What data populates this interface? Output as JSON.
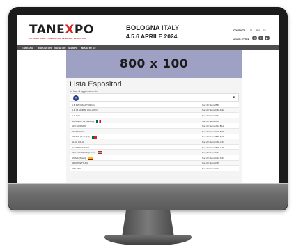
{
  "header": {
    "logo_prefix": "TANE",
    "logo_x": "X",
    "logo_suffix": "PO",
    "logo_sub": "INTERNATIONAL FUNERAL AND CEMETERY EXHIBITION",
    "city_bold": "BOLOGNA",
    "city_rest": " ITALY",
    "date": "4.5.6 APRILE 2024",
    "contatti": "CONTATTI",
    "languages": [
      "IT",
      "EN",
      "ES"
    ],
    "newsletter": "NEWSLETTER"
  },
  "nav": {
    "items": [
      "TANEXPO",
      "ESPOSITORI",
      "VISITATORI",
      "STAMPA",
      "INDUSTRY 4.0"
    ]
  },
  "banner": {
    "text": "800 x 100"
  },
  "list": {
    "title": "Lista Espositori",
    "subtitle": "In fase di aggiornamento",
    "filter_letter": "A",
    "filter_arrow": "▾"
  },
  "exhibitors": [
    {
      "name": "A.B.MANUFACTURING",
      "stand": "Hall 30 Stand B30"
    },
    {
      "name": "A.F. DI MARINI GIULIANO",
      "stand": "Hall 29 Stand D40-D42"
    },
    {
      "name": "A.G.O.D.",
      "stand": "Hall 29 Stand E34"
    },
    {
      "name": "AGNALAVITE (Mexico)",
      "stand": "Hall 30 Stand B06",
      "flag": "mexico"
    },
    {
      "name": "AFO CESARIO",
      "stand": "Hall 29 Stand A14-B11"
    },
    {
      "name": "AFFRESCO",
      "stand": "Hall 29 Stand E10-B31"
    },
    {
      "name": "AHMAR (Portugal)",
      "stand": "Hall 29 Stand B36-B41",
      "flag": "portugal"
    },
    {
      "name": "ALDA ITALIA",
      "stand": "Hall 29 Stand C30-C34"
    },
    {
      "name": "ALTAIR FUNERAL",
      "stand": "Hall 29 Stand B06-C11"
    },
    {
      "name": "ANGEL VIDEOS (Latvia)",
      "stand": "Hall 30 Stand E71",
      "flag": "latvia"
    },
    {
      "name": "ANIMA (Spain)",
      "stand": "Hall 29 Stand D22-D31",
      "flag": "spain"
    },
    {
      "name": "ARCHITETTURA",
      "stand": "Hall 29 Stand D35"
    },
    {
      "name": "ARGENIA",
      "stand": "Hall 29 Stand D27"
    }
  ],
  "colors": {
    "banner": "#9ea0c4",
    "nav": "#4e4e4e",
    "accent_red": "#d62a2a",
    "filter_circle": "#2b3f8f"
  }
}
